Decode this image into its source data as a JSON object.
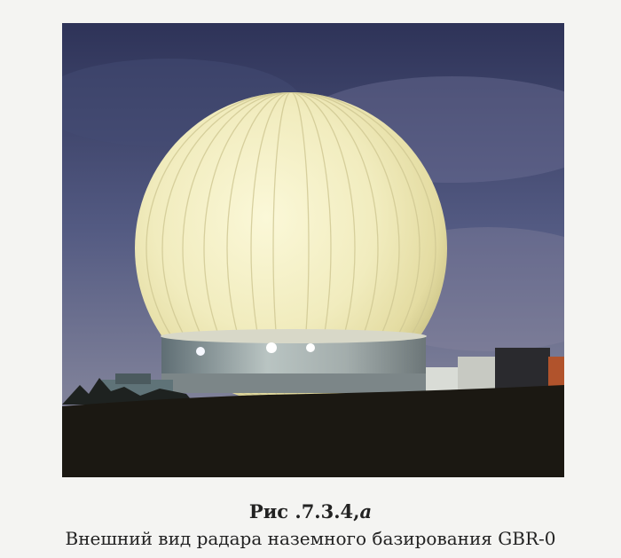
{
  "caption": {
    "figure_number": "Рис .7.3.4,",
    "figure_suffix": "а",
    "description": "Внешний вид радара наземного базирования GBR-0"
  },
  "colors": {
    "sky": "#3a4068",
    "dome": "#f2eec0",
    "ground": "#1b1812",
    "page": "#f4f4f2"
  }
}
